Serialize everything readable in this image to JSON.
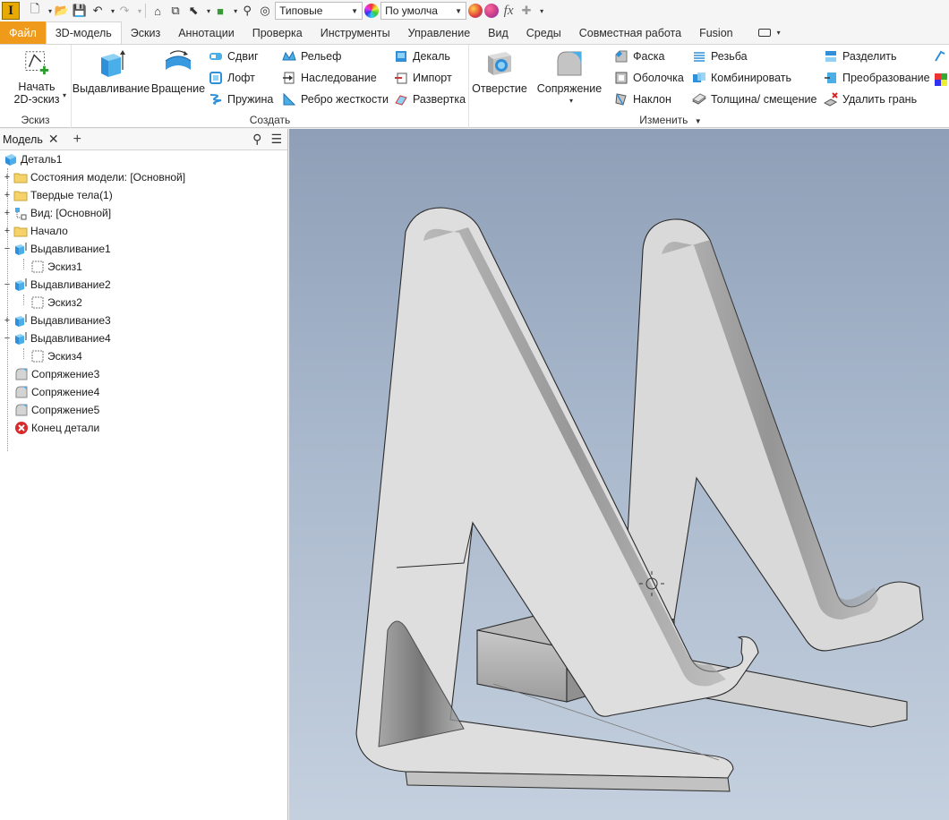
{
  "quick_access": {
    "app_letter": "I",
    "appearance_value": "Типовые",
    "material_value": "По умолча",
    "fx_label": "fx"
  },
  "tabs": [
    {
      "label": "Файл"
    },
    {
      "label": "3D-модель"
    },
    {
      "label": "Эскиз"
    },
    {
      "label": "Аннотации"
    },
    {
      "label": "Проверка"
    },
    {
      "label": "Инструменты"
    },
    {
      "label": "Управление"
    },
    {
      "label": "Вид"
    },
    {
      "label": "Среды"
    },
    {
      "label": "Совместная работа"
    },
    {
      "label": "Fusion"
    }
  ],
  "ribbon": {
    "sketch_group": {
      "title": "Эскиз",
      "start_sketch_line1": "Начать",
      "start_sketch_line2": "2D-эскиз"
    },
    "create_group": {
      "title": "Создать",
      "extrude": "Выдавливание",
      "revolve": "Вращение",
      "sweep": "Сдвиг",
      "loft": "Лофт",
      "coil": "Пружина",
      "emboss": "Рельеф",
      "derive": "Наследование",
      "rib": "Ребро жесткости",
      "decal": "Декаль",
      "import": "Импорт",
      "unfold": "Развертка"
    },
    "modify_group": {
      "title": "Изменить",
      "hole": "Отверстие",
      "fillet": "Сопряжение",
      "chamfer": "Фаска",
      "shell": "Оболочка",
      "draft": "Наклон",
      "thread": "Резьба",
      "combine": "Комбинировать",
      "thicken": "Толщина/ смещение",
      "split": "Разделить",
      "direct": "Преобразование",
      "delete_face": "Удалить грань"
    }
  },
  "browser": {
    "tab_label": "Модель",
    "items": [
      {
        "label": "Деталь1",
        "icon": "part-icon"
      },
      {
        "label": "Состояния модели: [Основной]",
        "icon": "folder-icon"
      },
      {
        "label": "Твердые тела(1)",
        "icon": "folder-icon"
      },
      {
        "label": "Вид: [Основной]",
        "icon": "view-icon"
      },
      {
        "label": "Начало",
        "icon": "folder-icon"
      },
      {
        "label": "Выдавливание1",
        "icon": "extrude-icon"
      },
      {
        "label": "Эскиз1",
        "icon": "sketch-icon"
      },
      {
        "label": "Выдавливание2",
        "icon": "extrude-icon"
      },
      {
        "label": "Эскиз2",
        "icon": "sketch-icon"
      },
      {
        "label": "Выдавливание3",
        "icon": "extrude-icon"
      },
      {
        "label": "Выдавливание4",
        "icon": "extrude-icon"
      },
      {
        "label": "Эскиз4",
        "icon": "sketch-icon"
      },
      {
        "label": "Сопряжение3",
        "icon": "fillet-icon"
      },
      {
        "label": "Сопряжение4",
        "icon": "fillet-icon"
      },
      {
        "label": "Сопряжение5",
        "icon": "fillet-icon"
      },
      {
        "label": "Конец детали",
        "icon": "end-of-part-icon"
      }
    ]
  },
  "colors": {
    "file_tab": "#ef9a1a",
    "viewport_top": "#8e9fb7",
    "viewport_bottom": "#c4d0de",
    "model_face": "#e4e4e4"
  }
}
